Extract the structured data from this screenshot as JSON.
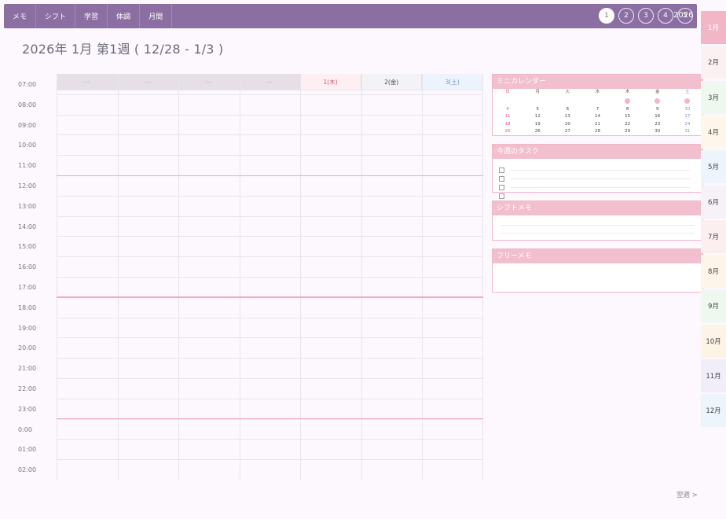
{
  "nav": {
    "items": [
      {
        "label": "メモ"
      },
      {
        "label": "シフト"
      },
      {
        "label": "学習"
      },
      {
        "label": "体調"
      },
      {
        "label": "月間"
      }
    ]
  },
  "week_pills": [
    {
      "label": "1",
      "active": true
    },
    {
      "label": "2",
      "active": false
    },
    {
      "label": "3",
      "active": false
    },
    {
      "label": "4",
      "active": false
    },
    {
      "label": "5",
      "active": false
    }
  ],
  "year_label": "2026",
  "title": "2026年 1月 第1週 ( 12/28 - 1/3 )",
  "times": [
    "07:00",
    "08:00",
    "09:00",
    "10:00",
    "11:00",
    "12:00",
    "13:00",
    "14:00",
    "15:00",
    "16:00",
    "17:00",
    "18:00",
    "19:00",
    "20:00",
    "21:00",
    "22:00",
    "23:00",
    "0:00",
    "01:00",
    "02:00"
  ],
  "days": [
    {
      "label": "---",
      "bg": "#e7dfe8",
      "color": "#b5b0ba"
    },
    {
      "label": "---",
      "bg": "#e7dfe8",
      "color": "#b5b0ba"
    },
    {
      "label": "---",
      "bg": "#e7dfe8",
      "color": "#b5b0ba"
    },
    {
      "label": "---",
      "bg": "#e7dfe8",
      "color": "#b5b0ba"
    },
    {
      "label": "1(木)",
      "bg": "#fdeff2",
      "color": "#d8557a"
    },
    {
      "label": "2(金)",
      "bg": "#f3f2f6",
      "color": "#444444"
    },
    {
      "label": "3(土)",
      "bg": "#edf3fd",
      "color": "#7c8fbd"
    }
  ],
  "mini_calendar": {
    "title": "ミニカレンダー",
    "weekdays": [
      "日",
      "月",
      "火",
      "水",
      "木",
      "金",
      "土"
    ],
    "weeks": [
      [
        "",
        "",
        "",
        "",
        "1",
        "2",
        "3"
      ],
      [
        "4",
        "5",
        "6",
        "7",
        "8",
        "9",
        "10"
      ],
      [
        "11",
        "12",
        "13",
        "14",
        "15",
        "16",
        "17"
      ],
      [
        "18",
        "19",
        "20",
        "21",
        "22",
        "23",
        "24"
      ],
      [
        "25",
        "26",
        "27",
        "28",
        "29",
        "30",
        "31"
      ]
    ],
    "highlighted": [
      "1",
      "2",
      "3"
    ]
  },
  "tasks_panel": {
    "title": "今週のタスク"
  },
  "shift_panel": {
    "title": "シフトメモ"
  },
  "free_panel": {
    "title": "フリーメモ"
  },
  "months": [
    {
      "label": "1月",
      "bg": "#f3b6c6",
      "active": true
    },
    {
      "label": "2月",
      "bg": "#fbf1f2"
    },
    {
      "label": "3月",
      "bg": "#eef8ee"
    },
    {
      "label": "4月",
      "bg": "#fdf6ea"
    },
    {
      "label": "5月",
      "bg": "#eef4fb"
    },
    {
      "label": "6月",
      "bg": "#f7f1f8"
    },
    {
      "label": "7月",
      "bg": "#fcefef"
    },
    {
      "label": "8月",
      "bg": "#fdf5e9"
    },
    {
      "label": "9月",
      "bg": "#eef8ef"
    },
    {
      "label": "10月",
      "bg": "#fdf4e6"
    },
    {
      "label": "11月",
      "bg": "#f1eef9"
    },
    {
      "label": "12月",
      "bg": "#eef4fb"
    }
  ],
  "next_link": "翌週 >",
  "colors": {
    "topbar": "#8b6fa3",
    "panel_header": "#f1bfcd",
    "separator": "#f0a9c1"
  }
}
